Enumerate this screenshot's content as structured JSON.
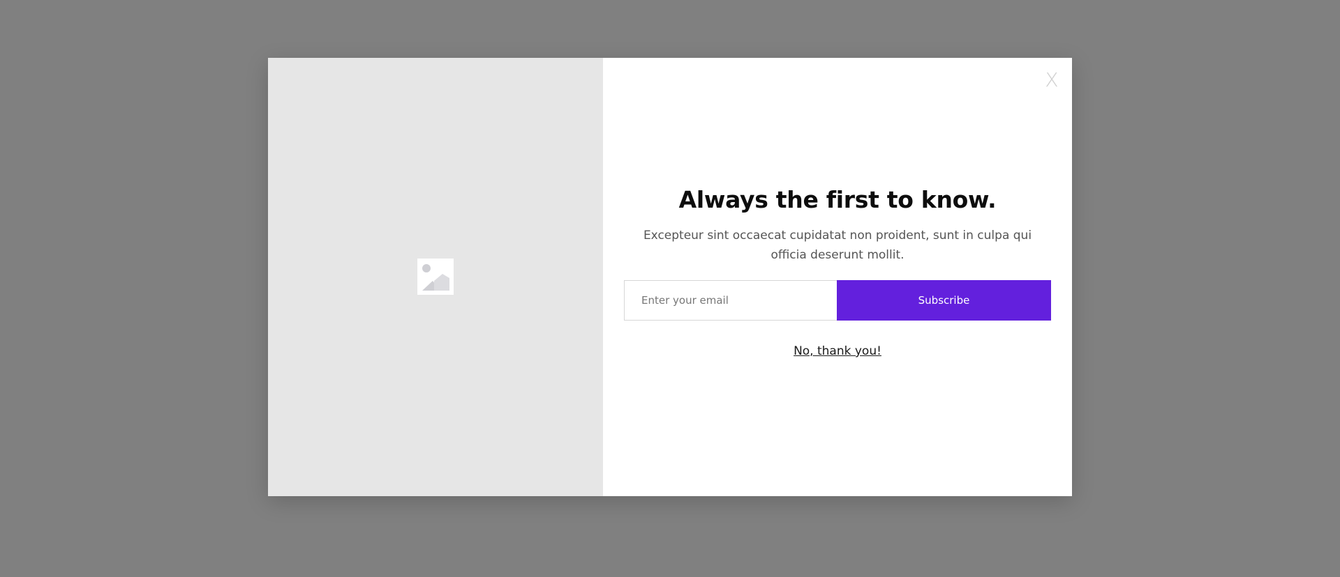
{
  "modal": {
    "close_label": "X",
    "image_icon": "image-placeholder-icon",
    "headline": "Always the first to know.",
    "description": "Excepteur sint occaecat cupidatat non proident, sunt in culpa qui officia deserunt mollit.",
    "email_input": {
      "value": "",
      "placeholder": "Enter your email"
    },
    "subscribe_label": "Subscribe",
    "decline_label": "No, thank you!"
  },
  "colors": {
    "backdrop": "#808080",
    "image_panel": "#e6e6e6",
    "accent": "#6320dd",
    "headline": "#0d0d0d",
    "body_text": "#555555"
  }
}
